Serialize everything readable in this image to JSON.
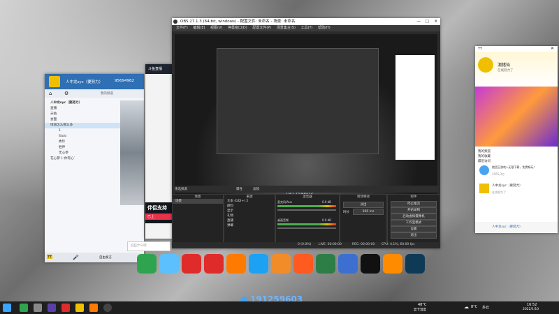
{
  "obs": {
    "title": "OBS 27.1.3 (64-bit, windows) - 配置文件: 未命名 - 场景: 未命名",
    "menu": [
      "文件(F)",
      "编辑(E)",
      "视图(V)",
      "停靠窗口(D)",
      "配置文件(P)",
      "场景集合(S)",
      "工具(T)",
      "帮助(H)"
    ],
    "watermark": "191259603",
    "status_label": "未选择源",
    "source_props": "属性",
    "source_filters": "滤镜",
    "docks": {
      "scenes": "场景",
      "sources": "来源",
      "mixer": "混音器",
      "transitions": "转场特效",
      "controls": "控件"
    },
    "scenes": [
      "场景"
    ],
    "sources": [
      "文本 (GDI+) 2",
      "颜料",
      "显示",
      "礼物",
      "直播",
      "弹幕"
    ],
    "mixer": [
      {
        "name": "麦克风/Aux",
        "db": "0.0 dB"
      },
      {
        "name": "桌面音频",
        "db": "0.0 dB"
      }
    ],
    "transition": {
      "type": "淡出",
      "duration_label": "时长",
      "duration": "300 ms"
    },
    "controls": [
      "停止推流",
      "开始录制",
      "启动虚拟摄像机",
      "工作室模式",
      "设置",
      "退出"
    ],
    "status": {
      "drop": "0 (0.0%)",
      "live": "LIVE: 00:00:00",
      "rec": "REC: 00:00:00",
      "cpu": "CPU: 4.1%, 60.00 fps"
    }
  },
  "chat_left": {
    "name": "人中龙syc（要努力）",
    "id": "95694962",
    "tab_label": "我的频道",
    "tree": [
      {
        "label": "人中龙syc（要努力）",
        "sub": []
      },
      {
        "label": "直播",
        "sub": []
      },
      {
        "label": "天佑",
        "sub": []
      },
      {
        "label": "会面",
        "sub": []
      },
      {
        "label": "绿道怎么那么多",
        "sub": []
      },
      {
        "label": "1",
        "sub": []
      },
      {
        "label": "Stois",
        "sub": []
      },
      {
        "label": "秀珍",
        "sub": []
      },
      {
        "label": "胜伸",
        "sub": []
      },
      {
        "label": "无心参",
        "sub": []
      },
      {
        "label": "花心萝卜:你有心`",
        "sub": []
      }
    ],
    "status_right": "在线努力",
    "input_placeholder": "说些什么吧",
    "bottom_buttons": [
      "自由发言",
      "播放伴奏",
      "录音"
    ],
    "brand": "YY"
  },
  "chat_mid": {
    "title": "斗鱼直播",
    "banner": "伴侣支持",
    "sub": "已上"
  },
  "yy_right": {
    "brand": "YY",
    "user": "澳猪仙",
    "status": "在线努力了",
    "channel_label": "的频道",
    "list": [
      "我的频道",
      "我的收藏",
      "最近访问"
    ],
    "rec1": "跑团玉游戏+无限下载，免费畅玩!",
    "rec1_sub": "3565,3亿",
    "rec2": "人中龙syc（要努力）",
    "rec2_sub": "在线努力了",
    "bottom": "人中龙syc（要努力）"
  },
  "watermark_center": "191259603",
  "taskbar": {
    "weather_temp": "8°C",
    "weather_desc": "多云",
    "time": "16:52",
    "date": "2022/1/10",
    "widget_temp": "48°C",
    "widget_label": "显卡温度"
  }
}
